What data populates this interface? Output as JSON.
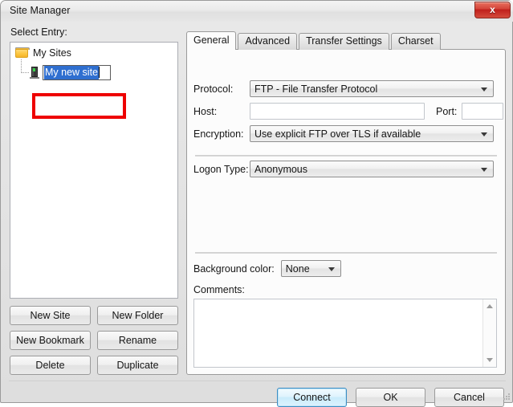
{
  "window": {
    "title": "Site Manager",
    "close_label": "x"
  },
  "left": {
    "select_entry_label": "Select Entry:",
    "tree": {
      "root_label": "My Sites",
      "editing_item_value": "My new site"
    },
    "buttons": [
      {
        "label": "New Site",
        "name": "new-site-button"
      },
      {
        "label": "New Folder",
        "name": "new-folder-button"
      },
      {
        "label": "New Bookmark",
        "name": "new-bookmark-button"
      },
      {
        "label": "Rename",
        "name": "rename-button"
      },
      {
        "label": "Delete",
        "name": "delete-button"
      },
      {
        "label": "Duplicate",
        "name": "duplicate-button"
      }
    ]
  },
  "tabs": [
    {
      "label": "General",
      "active": true
    },
    {
      "label": "Advanced",
      "active": false
    },
    {
      "label": "Transfer Settings",
      "active": false
    },
    {
      "label": "Charset",
      "active": false
    }
  ],
  "general": {
    "protocol_label": "Protocol:",
    "protocol_value": "FTP - File Transfer Protocol",
    "host_label": "Host:",
    "host_value": "",
    "port_label": "Port:",
    "port_value": "",
    "encryption_label": "Encryption:",
    "encryption_value": "Use explicit FTP over TLS if available",
    "logon_type_label": "Logon Type:",
    "logon_type_value": "Anonymous",
    "background_color_label": "Background color:",
    "background_color_value": "None",
    "comments_label": "Comments:",
    "comments_value": ""
  },
  "footer": {
    "connect_label": "Connect",
    "ok_label": "OK",
    "cancel_label": "Cancel"
  },
  "colors": {
    "accent_default_button": "#3c8ec4",
    "selection_blue": "#2f6fd0",
    "annotation_red": "#ee0000",
    "close_red": "#c0201c"
  }
}
